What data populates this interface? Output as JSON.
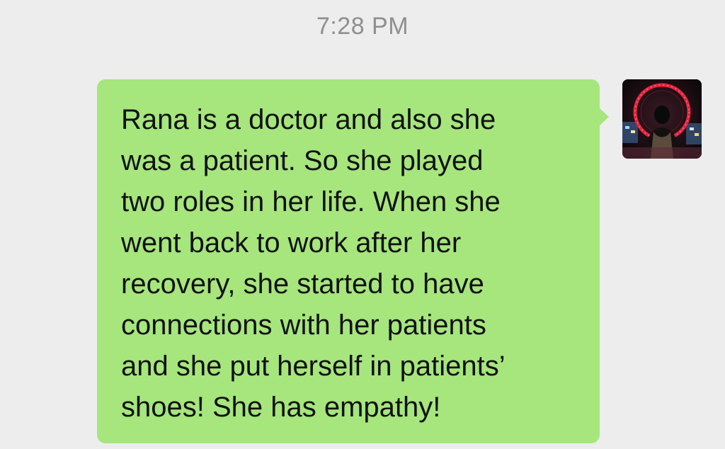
{
  "chat": {
    "timestamp": "7:28 PM",
    "messages": [
      {
        "direction": "outgoing",
        "text": "Rana is a doctor and also she\nwas a patient. So she played\ntwo roles in her life. When she\nwent back to work after her\nrecovery, she started to have\nconnections with her patients\nand she put herself in patients’\nshoes! She has empathy!",
        "bubble_color": "#a6e67d",
        "avatar_icon": "user-avatar-ferris-wheel-photo"
      }
    ]
  },
  "colors": {
    "background": "#ededed",
    "timestamp_text": "#8f8f8f",
    "message_text": "#111111"
  }
}
